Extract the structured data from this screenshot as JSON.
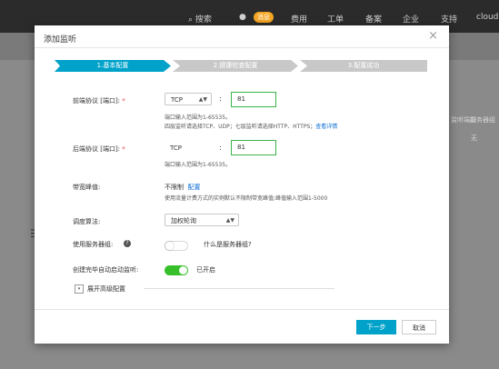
{
  "topbar": {
    "search": "搜索",
    "badge": "消息",
    "cost": "费用",
    "tickets": "工单",
    "record": "备案",
    "enterprise": "企业",
    "support": "支持",
    "cloud": "cloud"
  },
  "background": {
    "col1": "监听端口",
    "col2": "服务器组",
    "cell": "无"
  },
  "modal": {
    "title": "添加监听",
    "close": "×",
    "steps": [
      "1.基本配置",
      "2.健康检查配置",
      "3.配置成功"
    ],
    "frontend": {
      "label": "前端协议 [端口]:",
      "required": "*",
      "protocol": "TCP",
      "colon": ":",
      "port": "81",
      "hint1": "端口输入范围为1-65535。",
      "hint2": "四层监听请选择TCP、UDP；七层监听请选择HTTP、HTTPS；",
      "details_link": "查看详情"
    },
    "backend": {
      "label": "后端协议 [端口]:",
      "required": "*",
      "protocol": "TCP",
      "colon": ":",
      "port": "81",
      "hint": "端口输入范围为1-65535。"
    },
    "bandwidth": {
      "label": "带宽峰值:",
      "value": "不限制",
      "config_link": "配置",
      "hint": "使用流量计费方式的实例默认不限制带宽峰值;峰值输入范围1-5000"
    },
    "algorithm": {
      "label": "调度算法:",
      "value": "加权轮询"
    },
    "server_group": {
      "label": "使用服务器组:",
      "help": "?",
      "link": "什么是服务器组?",
      "enabled": false
    },
    "auto_start": {
      "label": "创建完毕自动启动监听:",
      "status": "已开启",
      "enabled": true
    },
    "advanced": {
      "toggle": "▾",
      "label": "展开高级配置"
    },
    "buttons": {
      "next": "下一步",
      "cancel": "取消"
    }
  },
  "colors": {
    "accent": "#00a2ca",
    "toggle_on": "#37c02a",
    "input_border": "#3cb34a",
    "link": "#0a6cd4",
    "required": "#e4393c"
  }
}
